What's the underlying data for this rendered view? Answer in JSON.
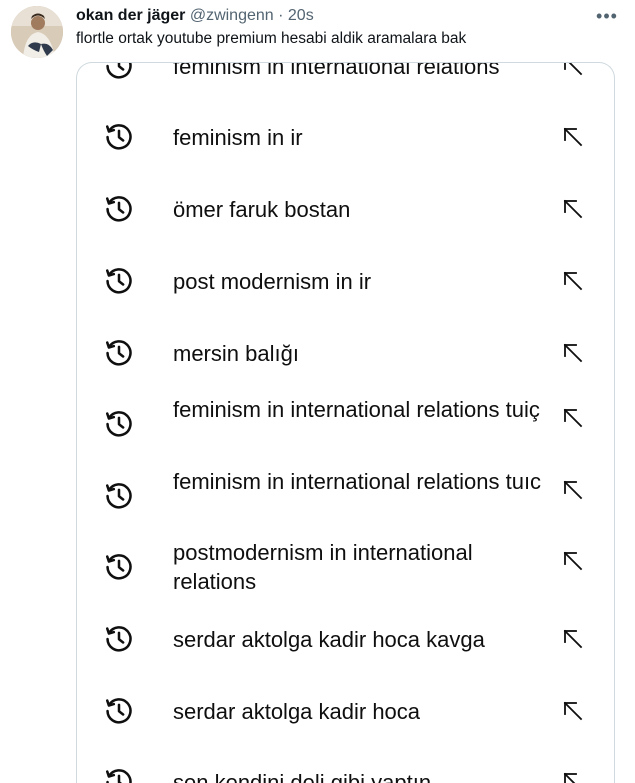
{
  "tweet": {
    "display_name": "okan der jäger",
    "handle": "@zwingenn",
    "separator": "·",
    "time": "20s",
    "more_label": "•••",
    "text": "flortle ortak youtube premium hesabi aldik aramalara bak"
  },
  "search_history": [
    {
      "query": "feminism in international relations"
    },
    {
      "query": "feminism in ir"
    },
    {
      "query": "ömer faruk bostan"
    },
    {
      "query": "post modernism in ir"
    },
    {
      "query": "mersin balığı"
    },
    {
      "query": "feminism in international relations tuiç"
    },
    {
      "query": "feminism in international relations tuıc"
    },
    {
      "query": "postmodernism in international relations"
    },
    {
      "query": "serdar aktolga kadir hoca kavga"
    },
    {
      "query": "serdar aktolga kadir hoca"
    },
    {
      "query": "sen kendini deli gibi yaptın"
    }
  ],
  "icons": {
    "history": "history-clock-icon",
    "fill": "arrow-up-left-icon",
    "more": "more-horizontal-icon"
  },
  "colors": {
    "text_primary": "#0f1419",
    "text_secondary": "#536471",
    "border": "#cfd9de"
  }
}
